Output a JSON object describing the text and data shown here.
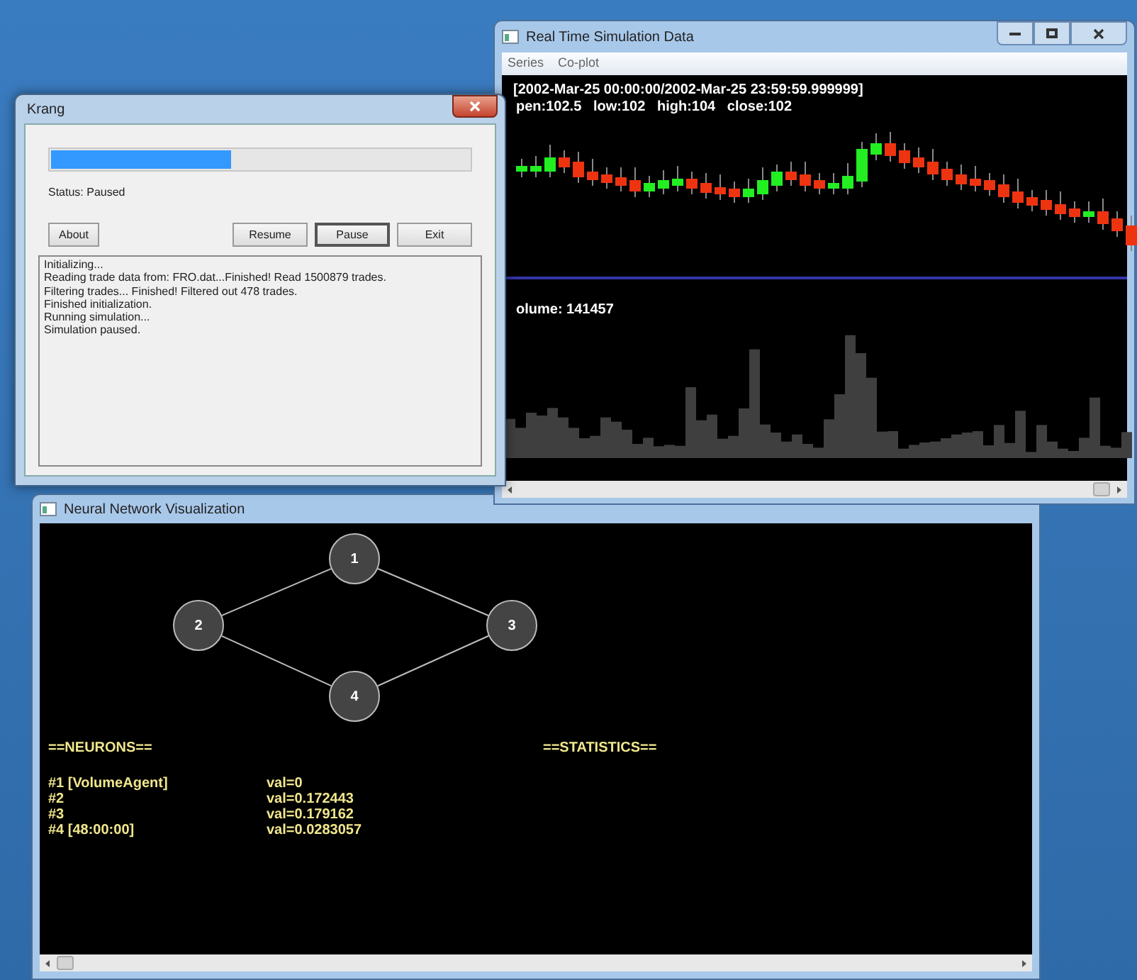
{
  "krang": {
    "title": "Krang",
    "progress": {
      "level": 0.43
    },
    "status": "Status: Paused",
    "buttons": [
      {
        "label": "About",
        "focused": false
      },
      {
        "label": "Resume",
        "focused": false
      },
      {
        "label": "Pause",
        "focused": true
      },
      {
        "label": "Exit",
        "focused": false
      }
    ],
    "log": [
      "Initializing...",
      "Reading trade data from: FRO.dat...Finished! Read 1500879 trades.",
      "Filtering trades... Finished! Filtered out 478 trades.",
      "Finished initialization.",
      "Running simulation...",
      "Simulation paused."
    ]
  },
  "realtime": {
    "title": "Real Time Simulation Data",
    "menu": [
      "Series",
      "Co-plot"
    ],
    "range_label": "[2002-Mar-25 00:00:00/2002-Mar-25 23:59:59.999999]",
    "ohlc_label": "pen:102.5   low:102   high:104   close:102",
    "volume_label": "olume: 141457"
  },
  "neural": {
    "title": "Neural Network Visualization",
    "nodes": [
      {
        "label": "1"
      },
      {
        "label": "2"
      },
      {
        "label": "3"
      },
      {
        "label": "4"
      }
    ],
    "neurons_heading": "==NEURONS==",
    "statistics_heading": "==STATISTICS==",
    "neurons": [
      {
        "name": "#1 [VolumeAgent]",
        "value": "val=0"
      },
      {
        "name": "#2",
        "value": "val=0.172443"
      },
      {
        "name": "#3",
        "value": "val=0.179162"
      },
      {
        "name": "#4 [48:00:00]",
        "value": "val=0.0283057"
      }
    ]
  }
}
